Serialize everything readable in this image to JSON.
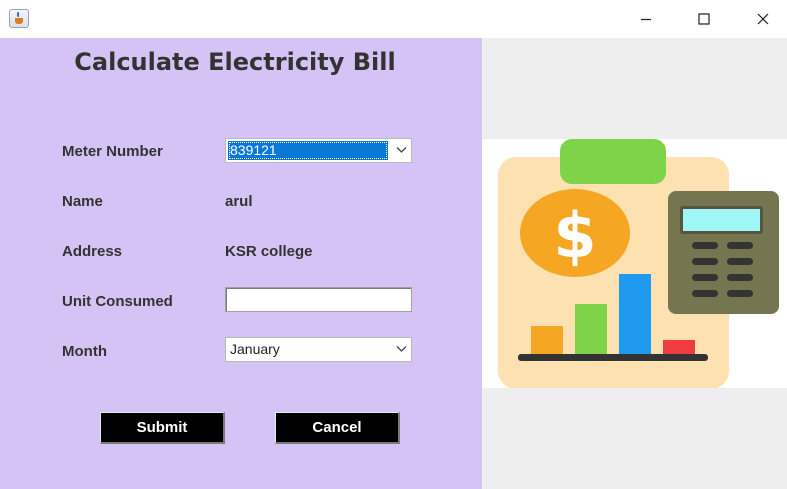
{
  "window": {
    "controls": [
      "minimize",
      "maximize",
      "close"
    ]
  },
  "form": {
    "title": "Calculate Electricity Bill",
    "fields": {
      "meter_label": "Meter Number",
      "meter_value": "839121",
      "name_label": "Name",
      "name_value": "arul",
      "address_label": "Address",
      "address_value": "KSR college",
      "unit_label": "Unit Consumed",
      "unit_value": "",
      "month_label": "Month",
      "month_value": "January"
    },
    "buttons": {
      "submit": "Submit",
      "cancel": "Cancel"
    }
  },
  "illustration": {
    "description_icons": [
      "dollar-coin-icon",
      "bar-chart-icon",
      "calculator-icon",
      "clipboard-icon"
    ],
    "colors": {
      "board": "#fde1b0",
      "clip": "#7ed348",
      "coin": "#f5a623",
      "bar1": "#f5a623",
      "bar2": "#7ed348",
      "bar3": "#1e9bf0",
      "bar4": "#f03c3c",
      "calculator_body": "#757550",
      "calculator_screen": "#9ff7f7"
    }
  },
  "colors": {
    "form_bg": "#d5c3f5",
    "selection": "#0a78d7",
    "button_bg": "#000000"
  }
}
